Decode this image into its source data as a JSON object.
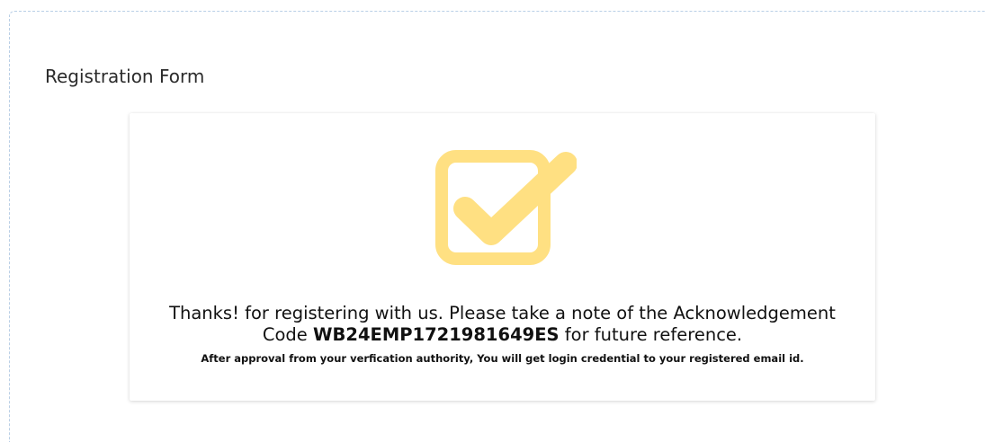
{
  "form": {
    "heading": "Registration Form"
  },
  "confirmation": {
    "message_prefix": "Thanks! for registering with us. Please take a note of the Acknowledgement",
    "code_prefix": "Code ",
    "ack_code": "WB24EMP1721981649ES",
    "code_suffix": " for future reference.",
    "note": "After approval from your verfication authority, You will get login credential to your registered email id.",
    "icon": "checkbox-checked-icon",
    "icon_color": "#FFE082"
  }
}
